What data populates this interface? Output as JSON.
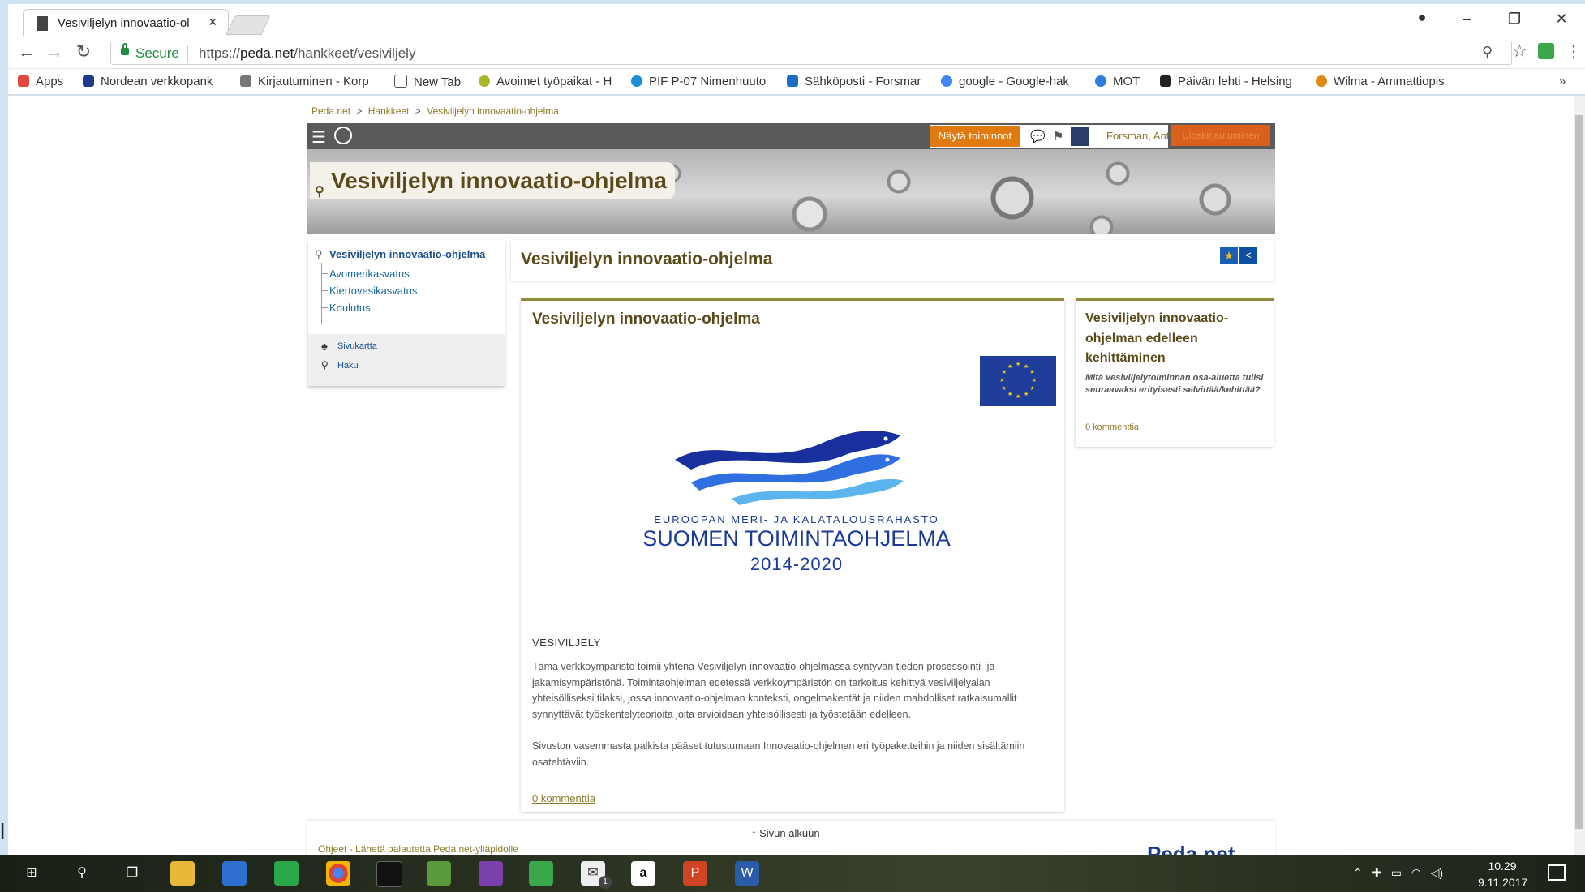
{
  "browser": {
    "tab_title": "Vesiviljelyn innovaatio-ol",
    "tab_close": "×",
    "window_buttons": [
      "–",
      "❐",
      "✕"
    ],
    "account_icon": "●",
    "nav": {
      "back": "←",
      "forward": "→",
      "reload": "↻"
    },
    "secure_label": "Secure",
    "url_scheme": "https://",
    "url_host": "peda.net",
    "url_path": "/hankkeet/vesiviljely",
    "zoom_icon": "⚲",
    "star_icon": "☆",
    "menu_icon": "⋮",
    "bookmarks": [
      {
        "label": "Apps",
        "icon": "apps-grid-icon",
        "color": "#e14a3a"
      },
      {
        "label": "Nordean verkkopank",
        "icon": "nordea-icon",
        "color": "#1d3b8c"
      },
      {
        "label": "Kirjautuminen - Korp",
        "icon": "k-icon",
        "color": "#777777"
      },
      {
        "label": "New Tab",
        "icon": "page-icon",
        "color": "#ffffff"
      },
      {
        "label": "Avoimet työpaikat - H",
        "icon": "te-icon",
        "color": "#a8b82a"
      },
      {
        "label": "PIF P-07 Nimenhuuto",
        "icon": "check-icon",
        "color": "#1b8ed8"
      },
      {
        "label": "Sähköposti - Forsmar",
        "icon": "outlook-icon",
        "color": "#1a6fc4"
      },
      {
        "label": "google - Google-hak",
        "icon": "google-icon",
        "color": "#4285f4"
      },
      {
        "label": "MOT",
        "icon": "m-icon",
        "color": "#2a7de1"
      },
      {
        "label": "Päivän lehti - Helsing",
        "icon": "hs-icon",
        "color": "#222222"
      },
      {
        "label": "Wilma - Ammattiopis",
        "icon": "wilma-icon",
        "color": "#e08a12"
      }
    ],
    "bookmarks_more": "»"
  },
  "site": {
    "breadcrumbs": [
      "Peda.net",
      "Hankkeet",
      "Vesiviljelyn innovaatio-ohjelma"
    ],
    "breadcrumb_sep": ">",
    "menu_icon": "☰",
    "show_actions": "Näytä toiminnot",
    "user_name": "Forsman, Antti",
    "logout_label": "Uloskirjautuminen",
    "banner_title": "Vesiviljelyn innovaatio-ohjelma",
    "sidebar": {
      "root": "Vesiviljelyn innovaatio-ohjelma",
      "items": [
        "Avomerikasvatus",
        "Kiertovesikasvatus",
        "Koulutus"
      ],
      "sitemap": "Sivukartta",
      "search": "Haku"
    },
    "main_title": "Vesiviljelyn innovaatio-ohjelma",
    "favorite_icon": "★",
    "share_icon": "<",
    "card": {
      "title": "Vesiviljelyn innovaatio-ohjelma",
      "logo_line1": "EUROOPAN MERI- JA KALATALOUSRAHASTO",
      "logo_line2": "SUOMEN TOIMINTAOHJELMA",
      "logo_line3": "2014-2020",
      "section_heading": "VESIVILJELY",
      "paragraph1": "Tämä verkkoympäristö toimii yhtenä Vesiviljelyn innovaatio-ohjelmassa syntyvän tiedon prosessointi- ja jakamisympäristönä. Toimintaohjelman edetessä verkkoympäristön on tarkoitus kehittyä vesiviljelyalan yhteisölliseksi tilaksi, jossa innovaatio-ohjelman konteksti, ongelmakentät ja niiden mahdolliset ratkaisumallit synnyttävät työskentelyteorioita joita arvioidaan yhteisöllisesti ja työstetään edelleen.",
      "paragraph2": "Sivuston vasemmasta palkista pääset tutustumaan Innovaatio-ohjelman eri työpaketteihin ja niiden sisältämiin osatehtäviin.",
      "comments": "0 kommenttia"
    },
    "side_card": {
      "title": "Vesiviljelyn innovaatio-ohjelman edelleen kehittäminen",
      "subtitle": "Mitä vesiviljelytoiminnan osa-aluetta tulisi seuraavaksi erityisesti selvittää/kehittää?",
      "comments": "0 kommenttia"
    },
    "footer": {
      "to_top": "Sivun alkuun",
      "links": "Ohjeet - Lähetä palautetta Peda.net-ylläpidolle",
      "logo": "Peda.net"
    }
  },
  "taskbar": {
    "clock_time": "10.29",
    "clock_date": "9.11.2017",
    "mail_badge": "1"
  },
  "colors": {
    "accent_orange": "#e07a0e",
    "title_brown": "#5a4a1a",
    "link_olive": "#8a7a2a",
    "eu_blue": "#1f3e9c"
  }
}
